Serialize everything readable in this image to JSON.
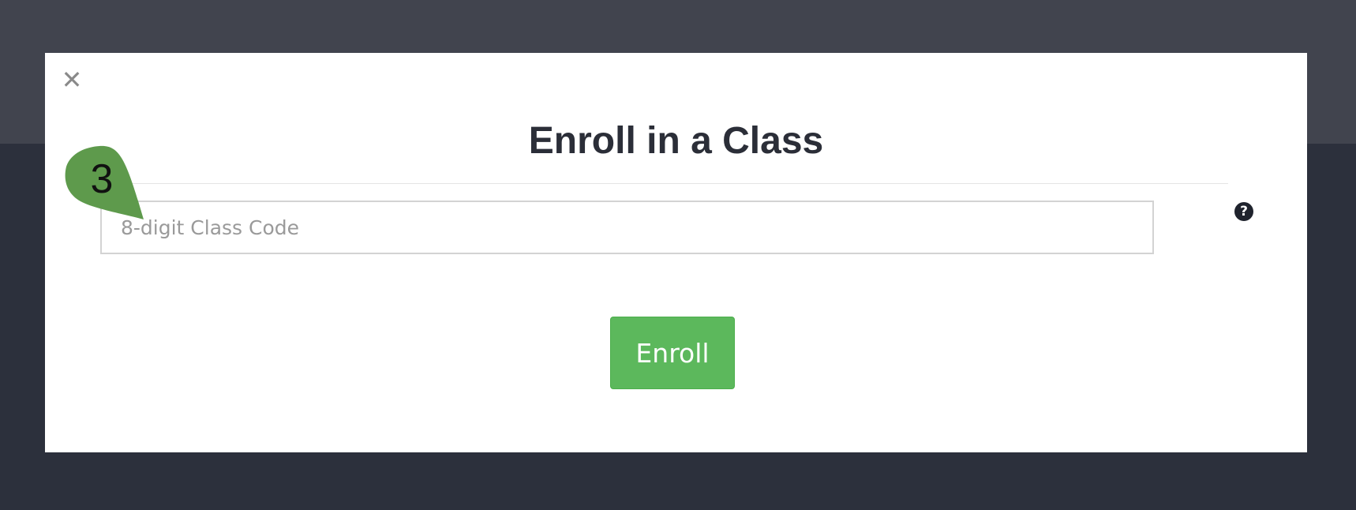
{
  "modal": {
    "close_glyph": "✕",
    "title": "Enroll in a Class",
    "class_code": {
      "placeholder": "8-digit Class Code",
      "value": ""
    },
    "help_glyph": "?",
    "enroll_label": "Enroll"
  },
  "annotation": {
    "step_number": "3",
    "color": "#5e9a4c"
  },
  "colors": {
    "page_background": "#2c303c",
    "header_strip": "#41444e",
    "modal_background": "#ffffff",
    "title": "#2b2e38",
    "enroll_button": "#5cb85c"
  }
}
